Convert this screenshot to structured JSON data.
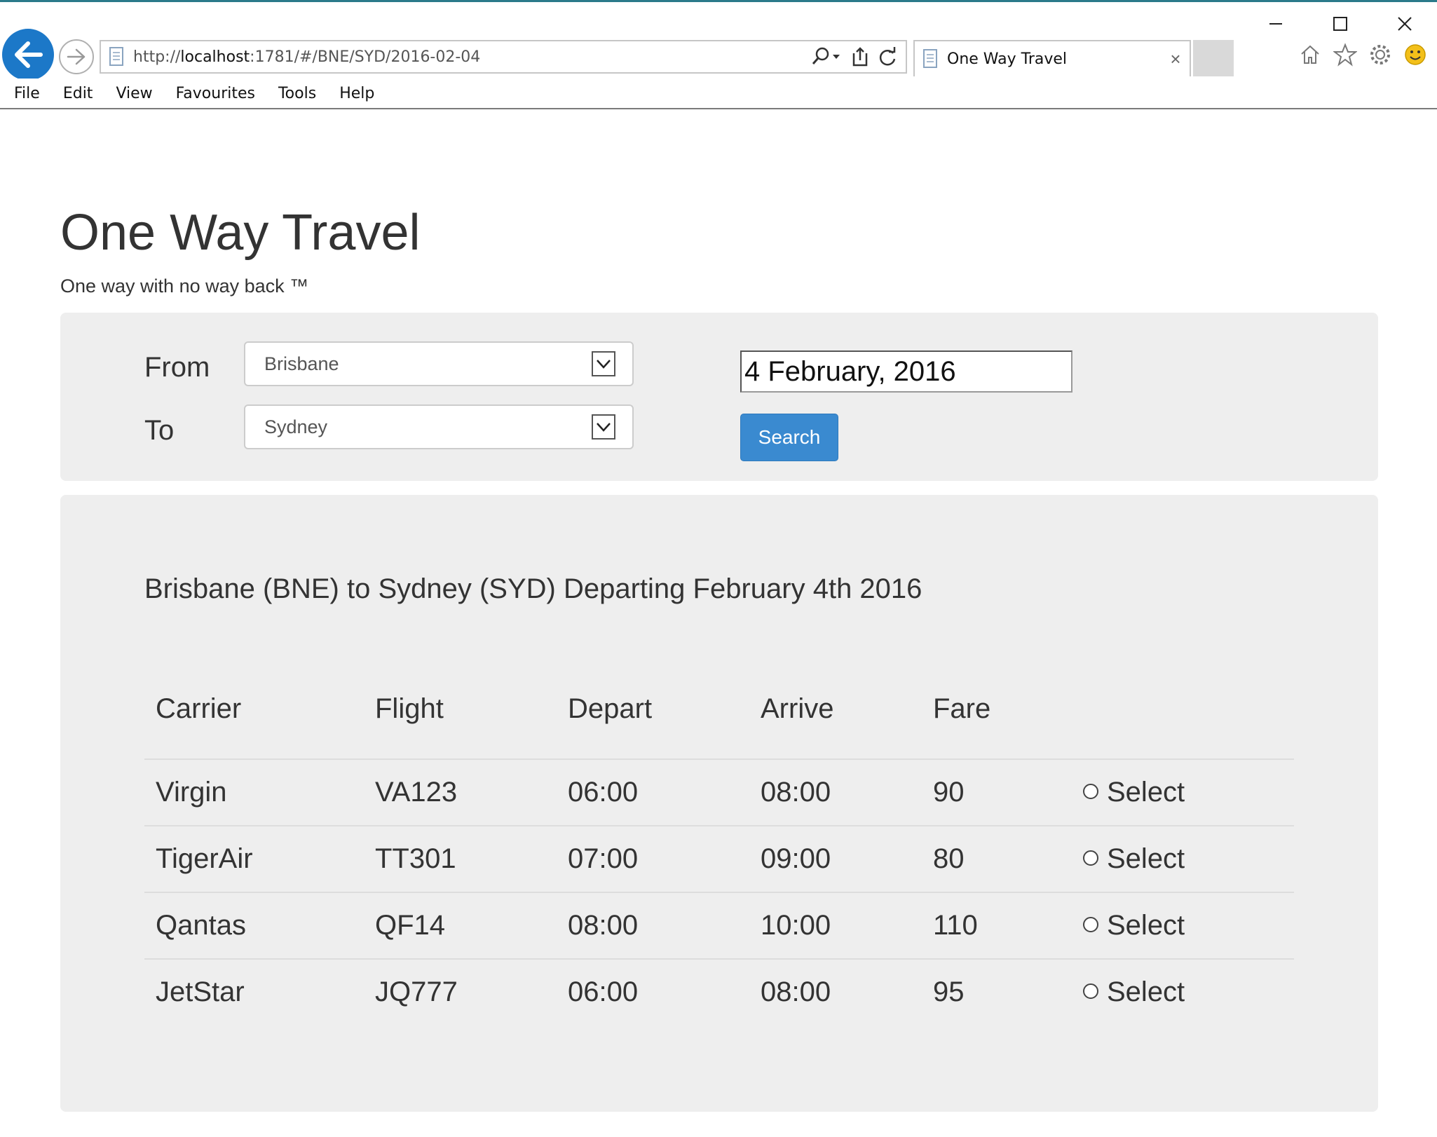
{
  "browser": {
    "url_prefix": "http://",
    "url_host": "localhost",
    "url_rest": ":1781/#/BNE/SYD/2016-02-04",
    "tab_title": "One Way Travel",
    "menu": [
      "File",
      "Edit",
      "View",
      "Favourites",
      "Tools",
      "Help"
    ]
  },
  "page": {
    "title": "One Way Travel",
    "tagline": "One way with no way back ™"
  },
  "search": {
    "from_label": "From",
    "from_value": "Brisbane",
    "to_label": "To",
    "to_value": "Sydney",
    "date_value": "4 February, 2016",
    "search_label": "Search"
  },
  "results": {
    "heading": "Brisbane (BNE) to Sydney (SYD) Departing February 4th 2016",
    "columns": [
      "Carrier",
      "Flight",
      "Depart",
      "Arrive",
      "Fare"
    ],
    "rows": [
      {
        "carrier": "Virgin",
        "flight": "VA123",
        "depart": "06:00",
        "arrive": "08:00",
        "fare": "90",
        "select": "Select"
      },
      {
        "carrier": "TigerAir",
        "flight": "TT301",
        "depart": "07:00",
        "arrive": "09:00",
        "fare": "80",
        "select": "Select"
      },
      {
        "carrier": "Qantas",
        "flight": "QF14",
        "depart": "08:00",
        "arrive": "10:00",
        "fare": "110",
        "select": "Select"
      },
      {
        "carrier": "JetStar",
        "flight": "JQ777",
        "depart": "06:00",
        "arrive": "08:00",
        "fare": "95",
        "select": "Select"
      }
    ]
  },
  "colors": {
    "accent": "#3a8ad0",
    "panel": "#eeeeee",
    "back_button": "#1c78c8"
  }
}
